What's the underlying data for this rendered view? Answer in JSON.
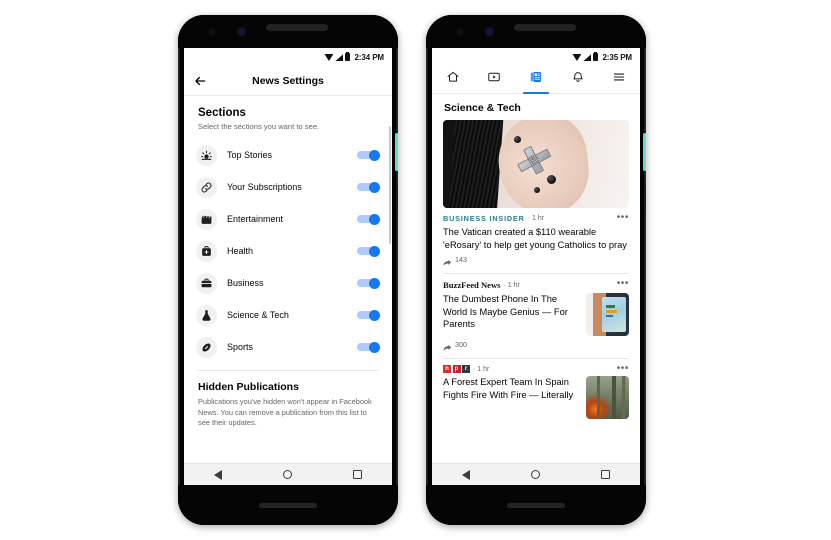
{
  "phones": {
    "left": {
      "status_bar": {
        "time": "2:34 PM",
        "wifi_icon": "wifi-icon",
        "signal_icon": "signal-icon",
        "battery_icon": "battery-icon"
      },
      "appbar": {
        "title": "News Settings",
        "back_icon": "back-arrow-icon"
      },
      "sections_header": {
        "title": "Sections",
        "subtitle": "Select the sections you want to see."
      },
      "sections": [
        {
          "label": "Top Stories",
          "icon": "top-stories-icon",
          "toggle": "on"
        },
        {
          "label": "Your Subscriptions",
          "icon": "link-icon",
          "toggle": "on"
        },
        {
          "label": "Entertainment",
          "icon": "clapperboard-icon",
          "toggle": "on"
        },
        {
          "label": "Health",
          "icon": "medical-bag-icon",
          "toggle": "on"
        },
        {
          "label": "Business",
          "icon": "briefcase-icon",
          "toggle": "on"
        },
        {
          "label": "Science & Tech",
          "icon": "flask-icon",
          "toggle": "on"
        },
        {
          "label": "Sports",
          "icon": "football-icon",
          "toggle": "on"
        }
      ],
      "hidden_publications": {
        "title": "Hidden Publications",
        "text": "Publications you've hidden won't appear in Facebook News. You can remove a publication from this list to see their updates."
      },
      "nav_bar": {
        "back": "back-triangle-icon",
        "home": "home-circle-icon",
        "recents": "recents-square-icon"
      }
    },
    "right": {
      "status_bar": {
        "time": "2:35 PM",
        "wifi_icon": "wifi-icon",
        "signal_icon": "signal-icon",
        "battery_icon": "battery-icon"
      },
      "tabs": [
        {
          "name": "home-tab",
          "icon": "home-icon",
          "active": false
        },
        {
          "name": "watch-tab",
          "icon": "video-icon",
          "active": false
        },
        {
          "name": "news-tab",
          "icon": "news-icon",
          "active": true
        },
        {
          "name": "notifications-tab",
          "icon": "bell-icon",
          "active": false
        },
        {
          "name": "menu-tab",
          "icon": "hamburger-icon",
          "active": false
        }
      ],
      "feed_title": "Science & Tech",
      "articles": [
        {
          "source": "BUSINESS INSIDER",
          "source_style": "business-insider",
          "time": "· 1 hr",
          "title": "The Vatican created a $110 wearable 'eRosary' to help get young Catholics to pray",
          "shares": "143",
          "media": "hero",
          "menu_icon": "more-options-icon",
          "share_icon": "share-icon"
        },
        {
          "source": "BuzzFeed News",
          "source_style": "buzzfeed",
          "time": "· 1 hr",
          "title": "The Dumbest Phone In The World Is Maybe Genius — For Parents",
          "shares": "300",
          "media": "thumb-tablet",
          "menu_icon": "more-options-icon",
          "share_icon": "share-icon"
        },
        {
          "source": "npr",
          "source_style": "npr",
          "time": "· 1 hr",
          "title": "A Forest Expert Team In Spain Fights Fire With Fire — Literally",
          "shares": "",
          "media": "thumb-forest",
          "menu_icon": "more-options-icon",
          "share_icon": "share-icon"
        }
      ],
      "nav_bar": {
        "back": "back-triangle-icon",
        "home": "home-circle-icon",
        "recents": "recents-square-icon"
      }
    }
  },
  "colors": {
    "accent_blue": "#1877f2",
    "toggle_track": "#aecbfa",
    "business_insider_teal": "#2f7f86",
    "npr_red": "#e12a2a",
    "power_button_teal": "#6fd8cf",
    "text_primary": "#050505",
    "text_secondary": "#65676b"
  }
}
